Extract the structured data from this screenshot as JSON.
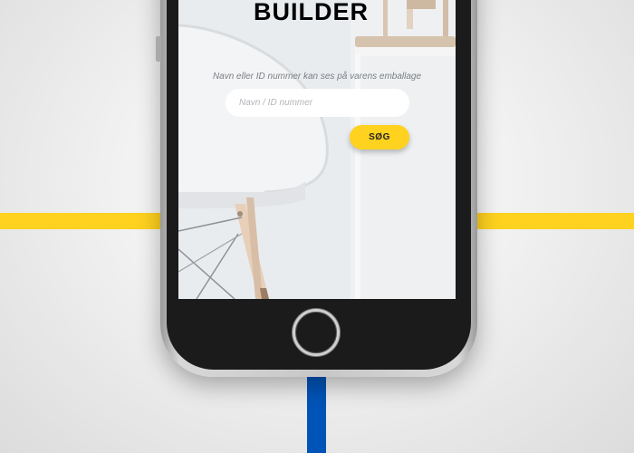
{
  "app": {
    "title": "BUILDER"
  },
  "search": {
    "hint": "Navn eller ID nummer kan ses på varens emballage",
    "placeholder": "Navn / ID nummer",
    "value": "",
    "button_label": "SØG"
  },
  "colors": {
    "accent_yellow": "#FFD21F",
    "accent_blue": "#0054B8",
    "phone_body": "#1b1b1b"
  },
  "icons": {
    "home_button": "home-button-icon"
  }
}
